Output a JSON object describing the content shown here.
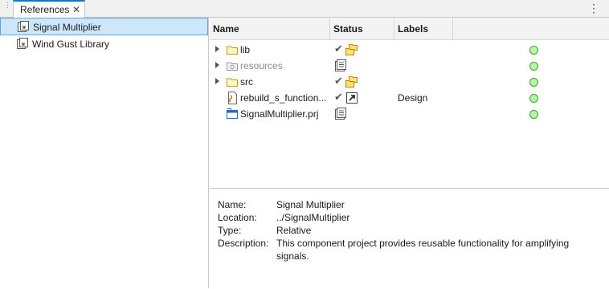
{
  "tab": {
    "label": "References"
  },
  "references": [
    {
      "label": "Signal Multiplier",
      "selected": true,
      "icon": "project-reference-icon"
    },
    {
      "label": "Wind Gust Library",
      "selected": false,
      "icon": "project-reference-icon"
    }
  ],
  "columns": {
    "name": "Name",
    "status": "Status",
    "labels": "Labels"
  },
  "files": [
    {
      "name": "lib",
      "type": "folder",
      "expandable": true,
      "status": "in-project-folder",
      "label": ""
    },
    {
      "name": "resources",
      "type": "resources-folder",
      "expandable": true,
      "status": "project-resources",
      "label": ""
    },
    {
      "name": "src",
      "type": "folder",
      "expandable": true,
      "status": "in-project-folder",
      "label": ""
    },
    {
      "name": "rebuild_s_function...",
      "type": "script",
      "expandable": false,
      "status": "in-project-shortcut",
      "label": "Design"
    },
    {
      "name": "SignalMultiplier.prj",
      "type": "project-file",
      "expandable": false,
      "status": "project-resources",
      "label": ""
    }
  ],
  "details": {
    "name_key": "Name:",
    "name_val": "Signal Multiplier",
    "location_key": "Location:",
    "location_val": "../SignalMultiplier",
    "type_key": "Type:",
    "type_val": "Relative",
    "description_key": "Description:",
    "description_val": "This component project provides reusable functionality for amplifying signals."
  },
  "colors": {
    "accent": "#0c7bc2",
    "selection": "#cde6fa",
    "ok_green": "#3da531"
  }
}
